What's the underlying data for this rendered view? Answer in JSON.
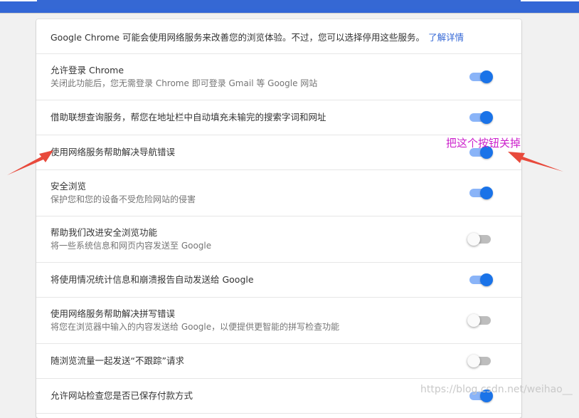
{
  "intro": {
    "text": "Google Chrome 可能会使用网络服务来改善您的浏览体验。不过，您可以选择停用这些服务。",
    "link": "了解详情"
  },
  "settings": [
    {
      "title": "允许登录 Chrome",
      "subtitle": "关闭此功能后，您无需登录 Chrome 即可登录 Gmail 等 Google 网站",
      "enabled": true
    },
    {
      "title": "借助联想查询服务，帮您在地址栏中自动填充未输完的搜索字词和网址",
      "subtitle": "",
      "enabled": true
    },
    {
      "title": "使用网络服务帮助解决导航错误",
      "subtitle": "",
      "enabled": true
    },
    {
      "title": "安全浏览",
      "subtitle": "保护您和您的设备不受危险网站的侵害",
      "enabled": true
    },
    {
      "title": "帮助我们改进安全浏览功能",
      "subtitle": "将一些系统信息和网页内容发送至 Google",
      "enabled": false
    },
    {
      "title": "将使用情况统计信息和崩溃报告自动发送给 Google",
      "subtitle": "",
      "enabled": true
    },
    {
      "title": "使用网络服务帮助解决拼写错误",
      "subtitle": "将您在浏览器中输入的内容发送给 Google，以便提供更智能的拼写检查功能",
      "enabled": false
    },
    {
      "title": "随浏览流量一起发送“不跟踪”请求",
      "subtitle": "",
      "enabled": false
    },
    {
      "title": "允许网站检查您是否已保存付款方式",
      "subtitle": "",
      "enabled": true
    }
  ],
  "annotation": "把这个按钮关掉",
  "watermark": "https://blog.csdn.net/weihao__",
  "colors": {
    "accent": "#1a73e8",
    "annotation": "#cc22cc",
    "arrow": "#e84a3c"
  }
}
